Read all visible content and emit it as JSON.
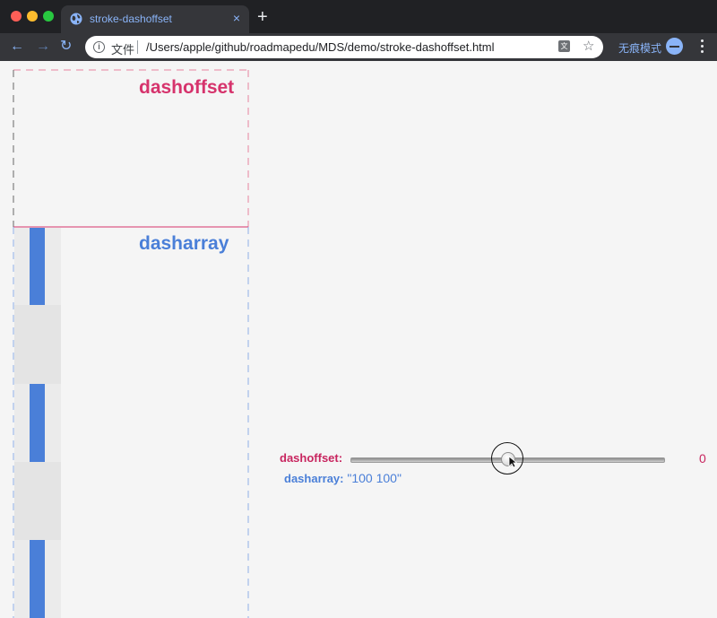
{
  "browser": {
    "tab_title": "stroke-dashoffset",
    "tab_close": "×",
    "new_tab": "+",
    "nav_back": "←",
    "nav_forward": "→",
    "nav_reload": "↻",
    "url_label": "文件",
    "url": "/Users/apple/github/roadmapedu/MDS/demo/stroke-dashoffset.html",
    "star": "☆",
    "translate_icon": "文",
    "incognito_label": "无痕模式"
  },
  "demo": {
    "offset_label": "dashoffset",
    "array_label": "dasharray",
    "colors": {
      "offset": "#d6336c",
      "array": "#4a7fd8",
      "dash_fill": "#e4e4e4",
      "stroke_blue": "#4a7fd8"
    }
  },
  "controls": {
    "dashoffset_label": "dashoffset:",
    "dashoffset_value": "0",
    "dasharray_label": "dasharray:",
    "dasharray_value": "\"100 100\""
  }
}
